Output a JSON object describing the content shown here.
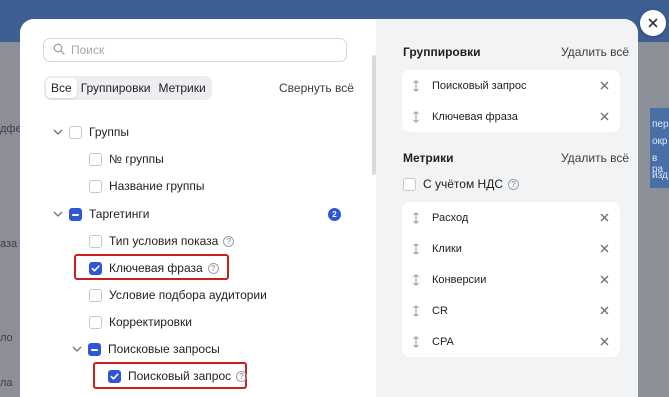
{
  "background": {
    "left_fragments": [
      "дфед",
      "аза",
      "ло",
      "ла"
    ],
    "right_fragments": [
      "пер",
      "окр",
      "в ра",
      "изд"
    ]
  },
  "search": {
    "placeholder": "Поиск"
  },
  "tabs": [
    {
      "label": "Все",
      "active": true
    },
    {
      "label": "Группировки",
      "active": false
    },
    {
      "label": "Метрики",
      "active": false
    }
  ],
  "collapse_all": "Свернуть всё",
  "tree": {
    "groups": {
      "label": "Группы",
      "state": "unchecked"
    },
    "group_number": {
      "label": "№ группы",
      "state": "unchecked"
    },
    "group_name": {
      "label": "Название группы",
      "state": "unchecked"
    },
    "targeting": {
      "label": "Таргетинги",
      "state": "indeterminate",
      "badge": "2"
    },
    "show_condition": {
      "label": "Тип условия показа",
      "state": "unchecked",
      "help": "?"
    },
    "keyword": {
      "label": "Ключевая фраза",
      "state": "checked",
      "help": "?"
    },
    "audience": {
      "label": "Условие подбора аудитории",
      "state": "unchecked"
    },
    "adjustments": {
      "label": "Корректировки",
      "state": "unchecked"
    },
    "search_queries": {
      "label": "Поисковые запросы",
      "state": "indeterminate"
    },
    "search_query": {
      "label": "Поисковый запрос",
      "state": "checked",
      "help": "?"
    }
  },
  "groupings": {
    "title": "Группировки",
    "remove_all": "Удалить всё",
    "items": [
      "Поисковый запрос",
      "Ключевая фраза"
    ]
  },
  "metrics": {
    "title": "Метрики",
    "remove_all": "Удалить всё",
    "vat_label": "С учётом НДС",
    "vat_help": "?",
    "items": [
      "Расход",
      "Клики",
      "Конверсии",
      "CR",
      "CPA"
    ]
  },
  "colors": {
    "accent": "#2f56d6",
    "highlight": "#c8201f",
    "panel": "#f2f3f5"
  }
}
